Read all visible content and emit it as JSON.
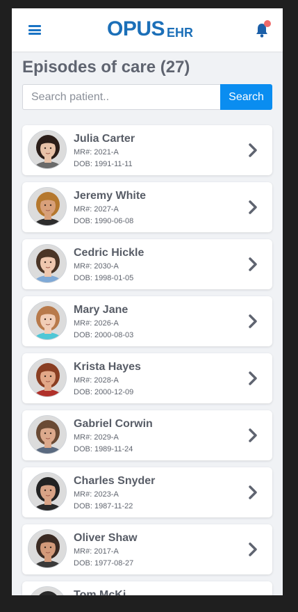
{
  "header": {
    "menu_icon": "hamburger-menu-icon",
    "logo_main": "OPUS",
    "logo_sub": "EHR",
    "notification_icon": "bell-icon",
    "brand_color": "#1b6fb8",
    "alert_dot_color": "#ef6a6a"
  },
  "page": {
    "title": "Episodes of care (27)"
  },
  "search": {
    "placeholder": "Search patient..",
    "button_label": "Search",
    "button_color": "#0a8df0"
  },
  "patients": [
    {
      "name": "Julia Carter",
      "mr": "MR#: 2021-A",
      "dob": "DOB: 1991-11-11",
      "skin": "#e8c2a8",
      "hair": "#2a1d18",
      "shirt": "#6a6a6a"
    },
    {
      "name": "Jeremy White",
      "mr": "MR#: 2027-A",
      "dob": "DOB: 1990-06-08",
      "skin": "#d8a07a",
      "hair": "#b5782e",
      "shirt": "#2d2d2d"
    },
    {
      "name": "Cedric Hickle",
      "mr": "MR#: 2030-A",
      "dob": "DOB: 1998-01-05",
      "skin": "#efc7ae",
      "hair": "#4b3526",
      "shirt": "#7fa9d6"
    },
    {
      "name": "Mary Jane",
      "mr": "MR#: 2026-A",
      "dob": "DOB: 2000-08-03",
      "skin": "#f1cdb6",
      "hair": "#b87a4b",
      "shirt": "#4ec7d6"
    },
    {
      "name": "Krista Hayes",
      "mr": "MR#: 2028-A",
      "dob": "DOB: 2000-12-09",
      "skin": "#e2a888",
      "hair": "#8a3e22",
      "shirt": "#b0302a"
    },
    {
      "name": "Gabriel Corwin",
      "mr": "MR#: 2029-A",
      "dob": "DOB: 1989-11-24",
      "skin": "#dca98c",
      "hair": "#6a4a34",
      "shirt": "#5a6a80"
    },
    {
      "name": "Charles Snyder",
      "mr": "MR#: 2023-A",
      "dob": "DOB: 1987-11-22",
      "skin": "#d8a386",
      "hair": "#222222",
      "shirt": "#2a2a2a"
    },
    {
      "name": "Oliver Shaw",
      "mr": "MR#: 2017-A",
      "dob": "DOB: 1977-08-27",
      "skin": "#d39a7a",
      "hair": "#3a2a22",
      "shirt": "#3a3a3a"
    },
    {
      "name": "Tom McKi",
      "mr": "",
      "dob": "",
      "skin": "#c89078",
      "hair": "#2a2a2a",
      "shirt": "#444444"
    }
  ],
  "row_action_icon": "chevron-right-icon",
  "chevron_color": "#5f6470"
}
